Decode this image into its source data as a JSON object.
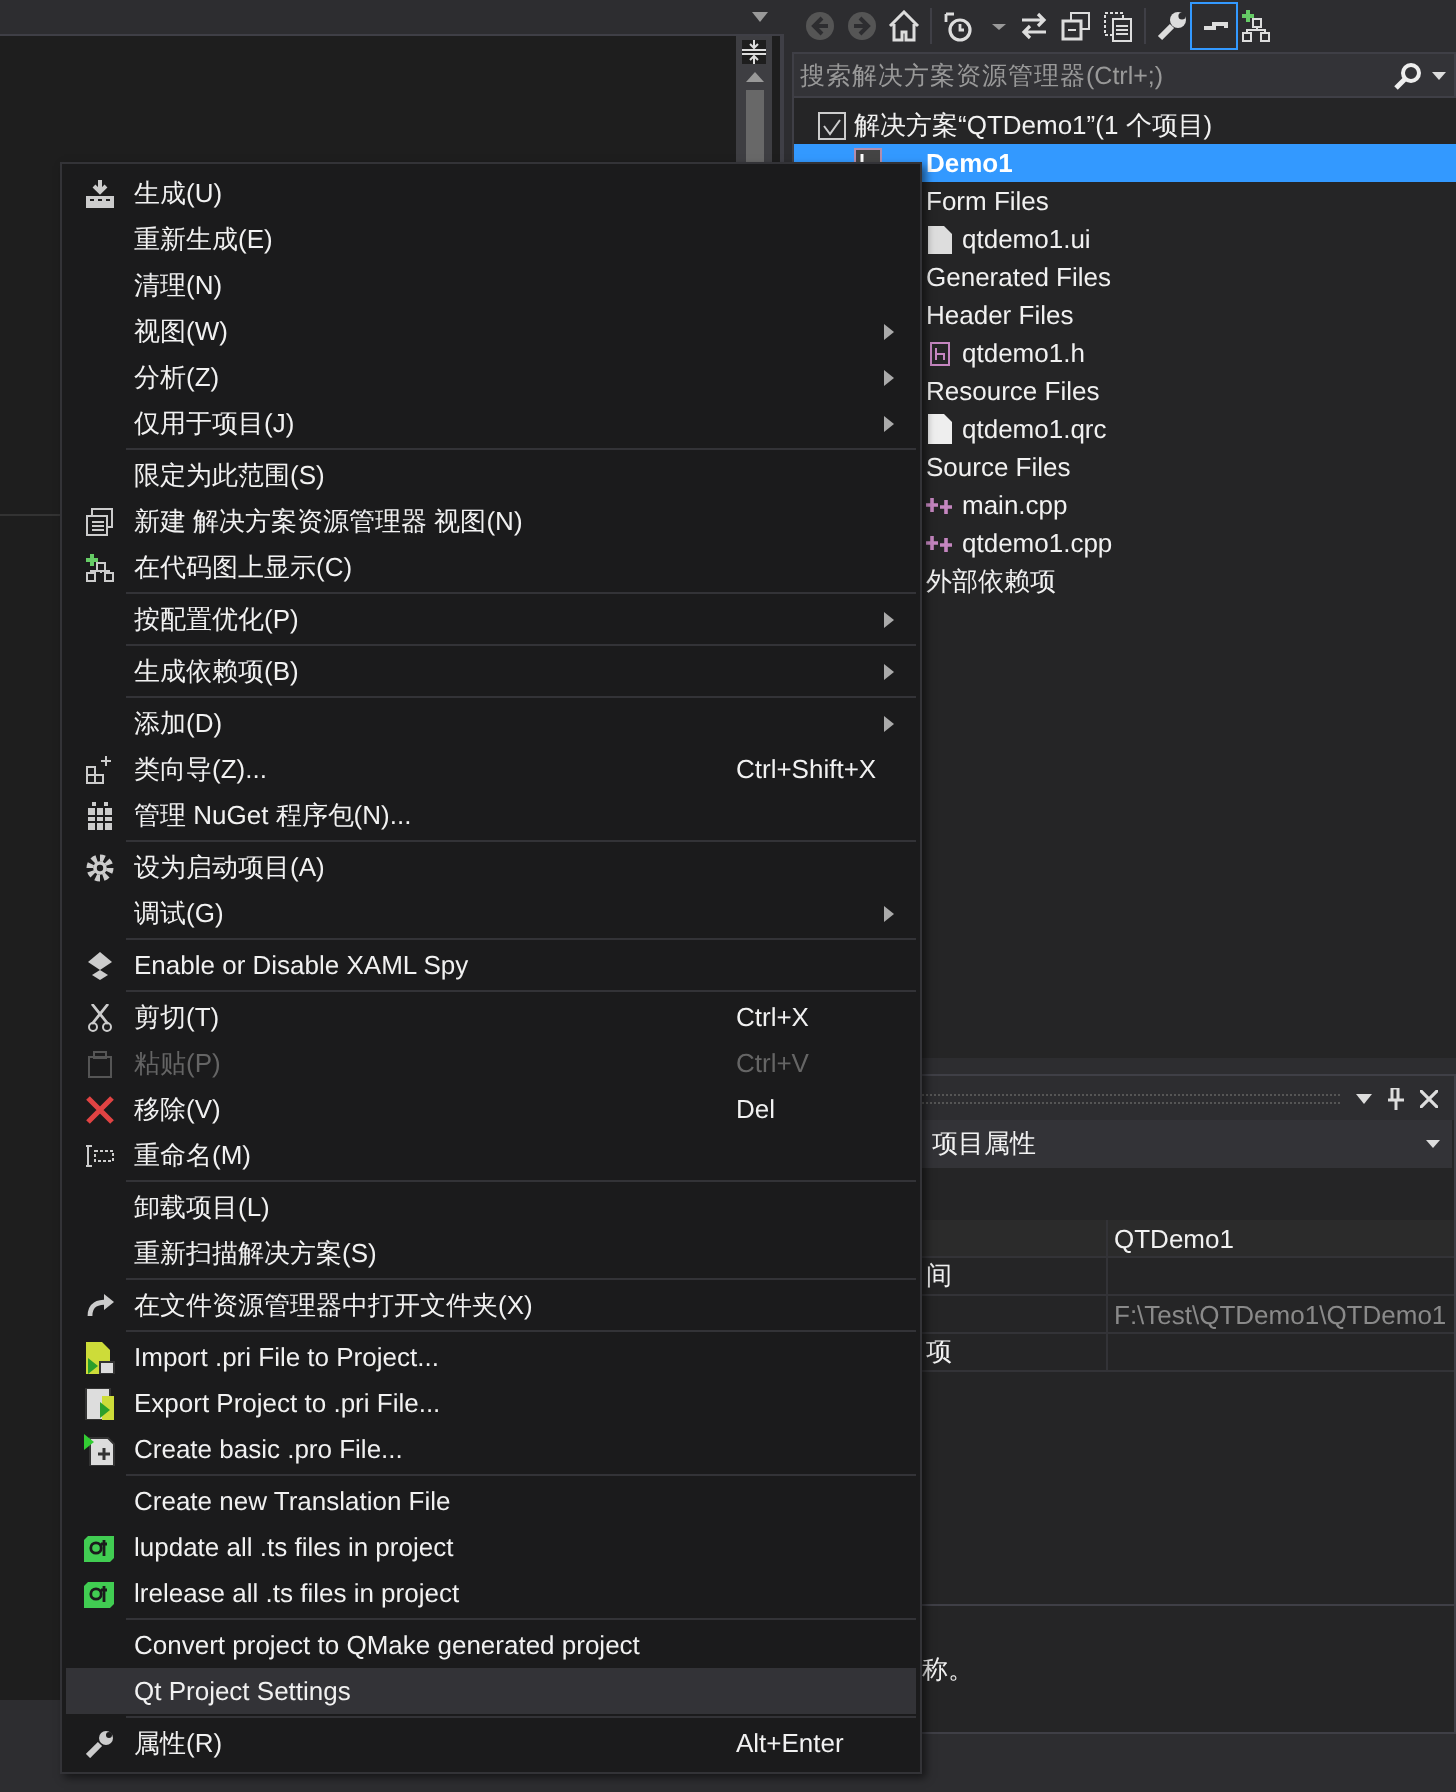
{
  "solution_explorer": {
    "search": {
      "placeholder": "搜索解决方案资源管理器(Ctrl+;)"
    },
    "tree": [
      {
        "label": "解决方案“QTDemo1”(1 个项目)",
        "kind": "solution",
        "selected": false,
        "children": [
          {
            "label": "Demo1",
            "kind": "project",
            "selected": true,
            "children": [
              {
                "label": "Form Files",
                "selected": false,
                "children": [
                  {
                    "label": "qtdemo1.ui",
                    "kind": "ui",
                    "selected": false
                  }
                ]
              },
              {
                "label": "Generated Files",
                "selected": false
              },
              {
                "label": "Header Files",
                "selected": false,
                "children": [
                  {
                    "label": "qtdemo1.h",
                    "kind": "header",
                    "selected": false
                  }
                ]
              },
              {
                "label": "Resource Files",
                "selected": false,
                "children": [
                  {
                    "label": "qtdemo1.qrc",
                    "kind": "file",
                    "selected": false
                  }
                ]
              },
              {
                "label": "Source Files",
                "selected": false,
                "children": [
                  {
                    "label": "main.cpp",
                    "kind": "cpp",
                    "selected": false
                  },
                  {
                    "label": "qtdemo1.cpp",
                    "kind": "cpp",
                    "selected": false
                  }
                ]
              },
              {
                "label": "外部依赖项",
                "selected": false
              }
            ]
          }
        ]
      }
    ]
  },
  "properties": {
    "object": "项目属性",
    "rows": [
      {
        "name": "",
        "value": "QTDemo1",
        "readonly": false
      },
      {
        "name": "间",
        "value": ""
      },
      {
        "name": "",
        "value": "F:\\Test\\QTDemo1\\QTDemo1",
        "readonly": true
      },
      {
        "name": "项",
        "value": ""
      }
    ],
    "description": "称。"
  },
  "context_menu": [
    [
      {
        "label": "生成(U)",
        "kind": "build"
      },
      {
        "label": "重新生成(E)"
      },
      {
        "label": "清理(N)"
      },
      {
        "label": "视图(W)",
        "submenu": true
      },
      {
        "label": "分析(Z)",
        "submenu": true
      },
      {
        "label": "仅用于项目(J)",
        "submenu": true
      }
    ],
    [
      {
        "label": "限定为此范围(S)"
      },
      {
        "label": "新建 解决方案资源管理器 视图(N)",
        "kind": "newview"
      },
      {
        "label": "在代码图上显示(C)",
        "kind": "codemap"
      }
    ],
    [
      {
        "label": "按配置优化(P)",
        "submenu": true
      }
    ],
    [
      {
        "label": "生成依赖项(B)",
        "submenu": true
      }
    ],
    [
      {
        "label": "添加(D)",
        "submenu": true
      },
      {
        "label": "类向导(Z)...",
        "shortcut": "Ctrl+Shift+X",
        "kind": "wizard"
      },
      {
        "label": "管理 NuGet 程序包(N)...",
        "kind": "package"
      }
    ],
    [
      {
        "label": "设为启动项目(A)",
        "kind": "gear"
      },
      {
        "label": "调试(G)",
        "submenu": true
      }
    ],
    [
      {
        "label": "Enable or Disable XAML Spy",
        "kind": "spy"
      }
    ],
    [
      {
        "label": "剪切(T)",
        "shortcut": "Ctrl+X",
        "kind": "cut"
      },
      {
        "label": "粘贴(P)",
        "shortcut": "Ctrl+V",
        "kind": "paste",
        "disabled": true
      },
      {
        "label": "移除(V)",
        "shortcut": "Del",
        "kind": "remove"
      },
      {
        "label": "重命名(M)",
        "kind": "rename"
      }
    ],
    [
      {
        "label": "卸载项目(L)"
      },
      {
        "label": "重新扫描解决方案(S)"
      }
    ],
    [
      {
        "label": "在文件资源管理器中打开文件夹(X)",
        "kind": "open"
      }
    ],
    [
      {
        "label": "Import .pri File to Project...",
        "kind": "import"
      },
      {
        "label": "Export Project to .pri File...",
        "kind": "export"
      },
      {
        "label": "Create basic .pro File...",
        "kind": "profile"
      }
    ],
    [
      {
        "label": "Create new Translation File"
      },
      {
        "label": "lupdate all .ts files in project",
        "kind": "qt"
      },
      {
        "label": "lrelease all .ts files in project",
        "kind": "qt"
      }
    ],
    [
      {
        "label": "Convert project to QMake generated project"
      },
      {
        "label": "Qt Project Settings",
        "selected": true
      }
    ],
    [
      {
        "label": "属性(R)",
        "shortcut": "Alt+Enter",
        "kind": "wrench"
      }
    ]
  ]
}
